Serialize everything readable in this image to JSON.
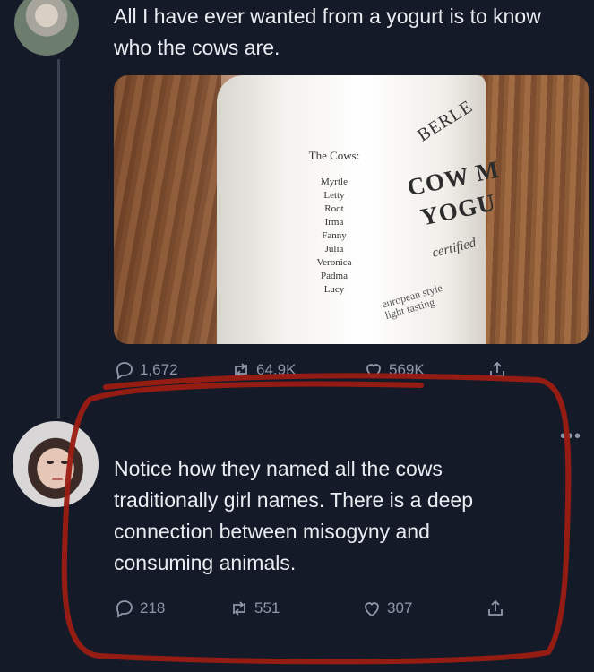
{
  "tweet1": {
    "text": "All I have ever wanted from a yogurt is to know who the cows are.",
    "image": {
      "cows_title": "The Cows:",
      "cow_names": [
        "Myrtle",
        "Letty",
        "Root",
        "Irma",
        "Fanny",
        "Julia",
        "Veronica",
        "Padma",
        "Lucy"
      ],
      "brand_top": "BERLE",
      "brand_line1": "COW M",
      "brand_line2": "YOGU",
      "certified": "certified",
      "euro_line1": "european style",
      "euro_line2": "light tasting"
    },
    "replies": "1,672",
    "retweets": "64.9K",
    "likes": "569K"
  },
  "tweet2": {
    "text": "Notice how they named all the cows traditionally girl names. There is a deep connection between misogyny and consuming animals.",
    "replies": "218",
    "retweets": "551",
    "likes": "307"
  },
  "icons": {
    "reply": "reply-icon",
    "retweet": "retweet-icon",
    "like": "heart-icon",
    "share": "share-icon",
    "more": "more-icon"
  },
  "colors": {
    "background": "#151a29",
    "text": "#e9ecf0",
    "muted": "#8f98a8",
    "annotation": "#9b1c12"
  }
}
